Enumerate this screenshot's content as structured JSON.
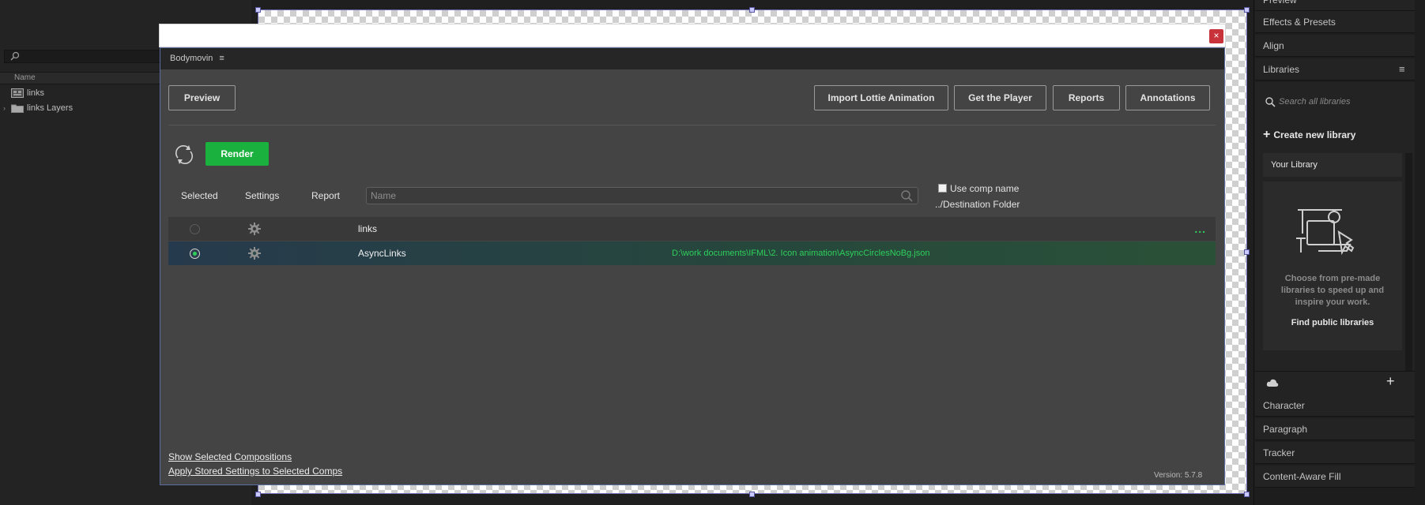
{
  "project": {
    "column_name": "Name",
    "items": [
      {
        "label": "links",
        "type": "composition"
      },
      {
        "label": "links Layers",
        "type": "folder"
      }
    ]
  },
  "right_panels": {
    "tabs_top": [
      "Preview",
      "Effects & Presets",
      "Align",
      "Libraries"
    ],
    "libraries": {
      "search_placeholder": "Search all libraries",
      "create_label": "Create new library",
      "your_library": "Your Library",
      "card_text": "Choose from pre-made libraries to speed up and inspire your work.",
      "find_label": "Find public libraries"
    },
    "tabs_bottom": [
      "Character",
      "Paragraph",
      "Tracker",
      "Content-Aware Fill"
    ]
  },
  "dialog": {
    "title": "Bodymovin",
    "menu_icon": "hamburger-icon",
    "close_glyph": "×",
    "buttons": {
      "preview": "Preview",
      "import": "Import Lottie Animation",
      "player": "Get the Player",
      "reports": "Reports",
      "annotations": "Annotations",
      "render": "Render"
    },
    "columns": {
      "selected": "Selected",
      "settings": "Settings",
      "report": "Report"
    },
    "name_placeholder": "Name",
    "use_comp_name": "Use comp name",
    "destination": "../Destination Folder",
    "compositions": [
      {
        "name": "links",
        "selected": false,
        "path": "",
        "more": "..."
      },
      {
        "name": "AsyncLinks",
        "selected": true,
        "path": "D:\\work documents\\IFML\\2. Icon animation\\AsyncCirclesNoBg.json",
        "more": ""
      }
    ],
    "links": {
      "show_selected": "Show Selected Compositions",
      "apply_stored": "Apply Stored Settings to Selected Comps"
    },
    "version": "Version: 5.7.8"
  },
  "colors": {
    "accent_green": "#1bb13f",
    "path_green": "#2ecf5b",
    "close_red": "#c8323a",
    "selected_row": "#2c4a55"
  }
}
